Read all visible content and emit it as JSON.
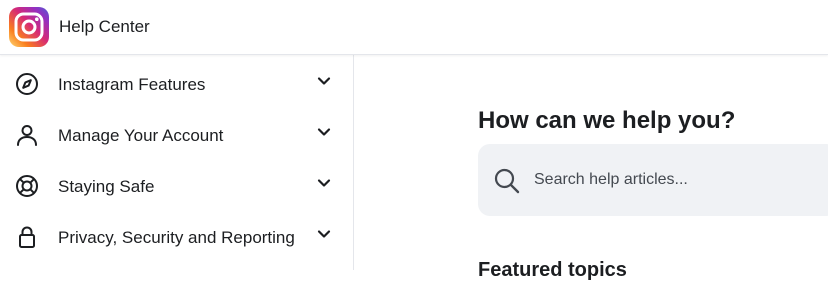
{
  "header": {
    "brand": "Help Center",
    "logo_icon": "instagram-logo-icon",
    "logo_colors": [
      "#feda75",
      "#fa7e1e",
      "#d62976",
      "#962fbf",
      "#4f5bd5"
    ]
  },
  "sidebar": {
    "items": [
      {
        "label": "Instagram Features",
        "icon": "compass-icon"
      },
      {
        "label": "Manage Your Account",
        "icon": "person-icon"
      },
      {
        "label": "Staying Safe",
        "icon": "lifebuoy-icon"
      },
      {
        "label": "Privacy, Security and Reporting",
        "icon": "lock-icon"
      }
    ],
    "expand_icon": "chevron-down-icon"
  },
  "main": {
    "title": "How can we help you?",
    "search": {
      "placeholder": "Search help articles...",
      "icon": "search-icon"
    },
    "featured_title": "Featured topics"
  }
}
